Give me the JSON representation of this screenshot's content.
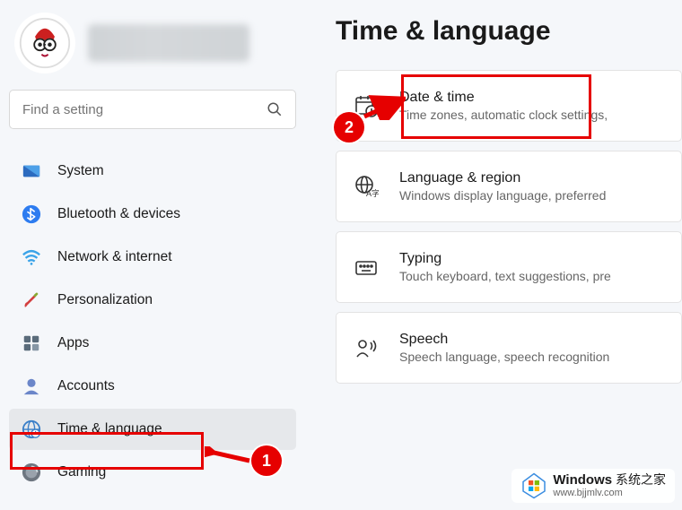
{
  "user": {
    "avatar_alt": "user-avatar"
  },
  "search": {
    "placeholder": "Find a setting"
  },
  "sidebar": {
    "items": [
      {
        "label": "System",
        "icon": "system-icon",
        "active": false
      },
      {
        "label": "Bluetooth & devices",
        "icon": "bluetooth-icon",
        "active": false
      },
      {
        "label": "Network & internet",
        "icon": "wifi-icon",
        "active": false
      },
      {
        "label": "Personalization",
        "icon": "brush-icon",
        "active": false
      },
      {
        "label": "Apps",
        "icon": "apps-icon",
        "active": false
      },
      {
        "label": "Accounts",
        "icon": "accounts-icon",
        "active": false
      },
      {
        "label": "Time & language",
        "icon": "globe-time-icon",
        "active": true
      },
      {
        "label": "Gaming",
        "icon": "gaming-icon",
        "active": false
      }
    ]
  },
  "main": {
    "title": "Time & language",
    "cards": [
      {
        "title": "Date & time",
        "desc": "Time zones, automatic clock settings,",
        "icon": "date-time-icon"
      },
      {
        "title": "Language & region",
        "desc": "Windows display language, preferred",
        "icon": "language-region-icon"
      },
      {
        "title": "Typing",
        "desc": "Touch keyboard, text suggestions, pre",
        "icon": "keyboard-icon"
      },
      {
        "title": "Speech",
        "desc": "Speech language, speech recognition",
        "icon": "speech-icon"
      }
    ]
  },
  "annotations": {
    "step1": "1",
    "step2": "2"
  },
  "watermark": {
    "brand": "Windows",
    "sub": "系统之家",
    "url": "www.bjjmlv.com"
  }
}
